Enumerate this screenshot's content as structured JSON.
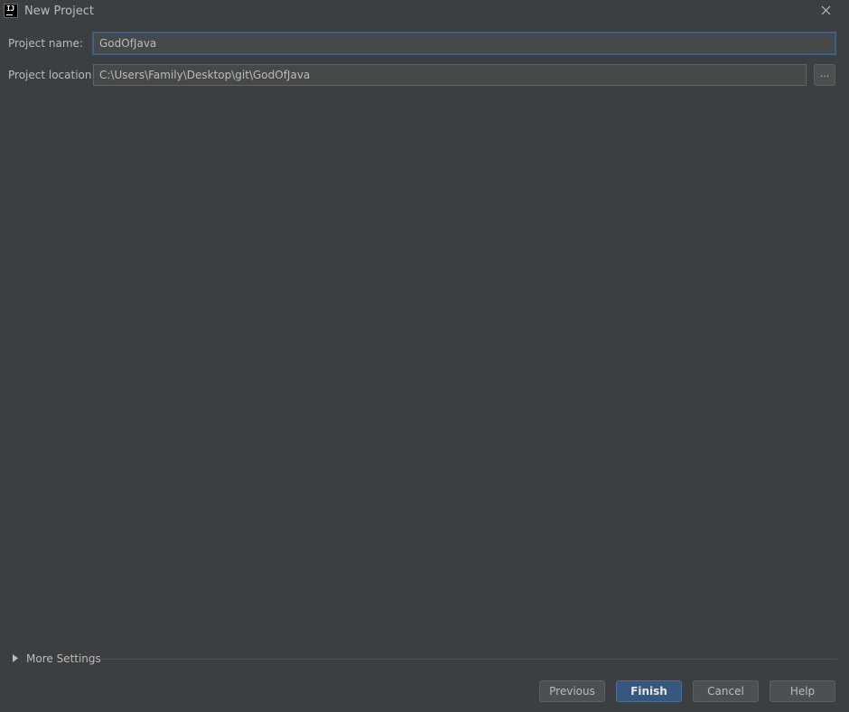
{
  "window": {
    "title": "New Project",
    "app_icon": "intellij-idea-icon",
    "close_icon": "close-icon"
  },
  "form": {
    "project_name": {
      "label": "Project name:",
      "value": "GodOfJava"
    },
    "project_location": {
      "label": "Project location:",
      "value": "C:\\Users\\Family\\Desktop\\git\\GodOfJava",
      "browse_label": "..."
    }
  },
  "more_settings": {
    "label": "More Settings",
    "icon": "expand-arrow-right-icon",
    "expanded": false
  },
  "buttons": {
    "previous": "Previous",
    "finish": "Finish",
    "cancel": "Cancel",
    "help": "Help"
  },
  "colors": {
    "background": "#3c3f41",
    "input_background": "#45494a",
    "focus_border": "#3d6185",
    "default_button": "#365880",
    "text": "#bbbbbb"
  }
}
